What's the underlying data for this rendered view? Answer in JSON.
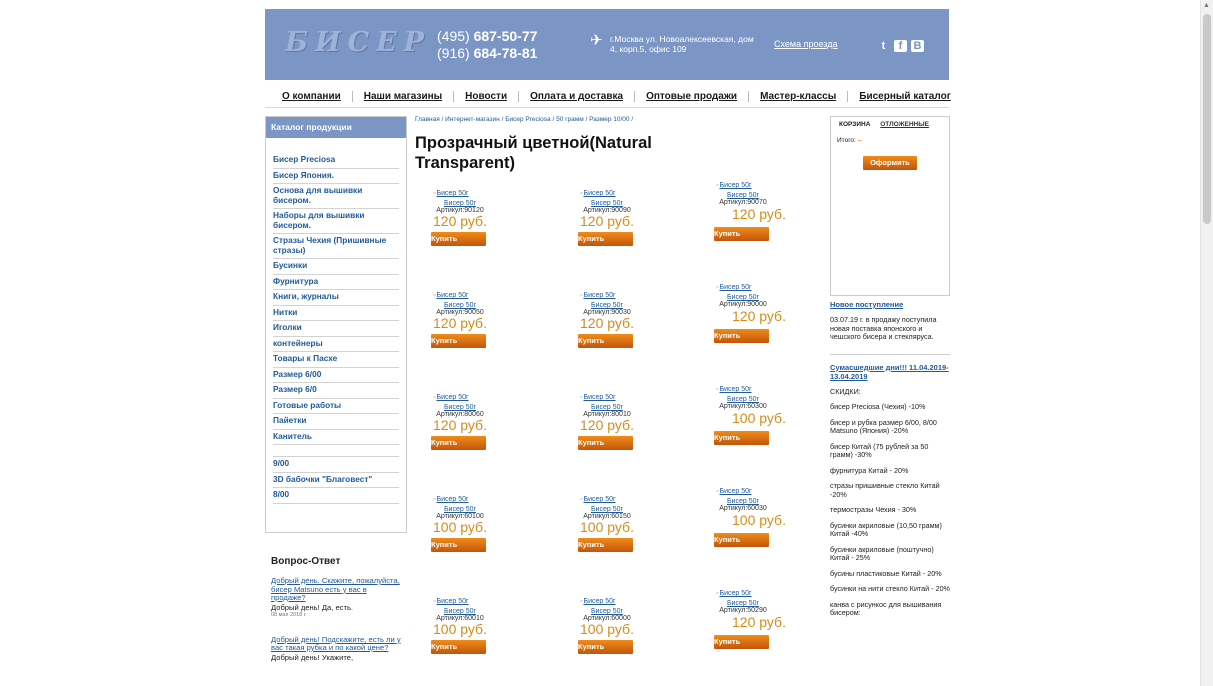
{
  "header": {
    "logo": "БИСЕР",
    "phone1_code": "(495)",
    "phone1": "687-50-77",
    "phone2_code": "(916)",
    "phone2": "684-78-81",
    "address": "г.Москва ул. Новоалексеевская, дом 4, корп.5, офис 109",
    "route_link": "Схема проезда",
    "social": [
      "twitter-icon",
      "facebook-icon",
      "vk-icon"
    ]
  },
  "nav": [
    "О компании",
    "Наши магазины",
    "Новости",
    "Оплата и доставка",
    "Оптовые продажи",
    "Мастер-классы",
    "Бисерный каталог"
  ],
  "sidebar": {
    "title": "Каталог продукции",
    "items": [
      "Бисер Preciosa",
      "Бисер Япония.",
      "Основа для вышивки бисером.",
      "Наборы для вышивки бисером.",
      "Стразы Чехия (Пришивные стразы)",
      "Бусинки",
      "Фурнитура",
      "Книги, журналы",
      "Нитки",
      "Иголки",
      "контейнеры",
      "Товары к Пасхе",
      "Размер 6/00",
      "Размер 6/0",
      "Готовые работы",
      "Пайетки",
      "Канитель",
      "",
      "9/00",
      "3D бабочки \"Благовест\"",
      "8/00"
    ]
  },
  "faq": {
    "title": "Вопрос-Ответ",
    "items": [
      {
        "q": "Добрый день. Скажите, пожалуйста, бисер Matsuno есть у вас в продаже?",
        "a": "Добрый день! Да, есть.",
        "d": "08 мая 2018 г."
      },
      {
        "q": "Добрый день! Подскажите, есть ли у вас такая рубка и по какой цене?",
        "a": "Добрый день! Укажите,",
        "d": ""
      }
    ]
  },
  "breadcrumb": [
    "Главная",
    "Интернет-магазин",
    "Бисер Preciosa",
    "50 грамм",
    "Размер 10/00"
  ],
  "page_title": "Прозрачный цветной(Natural Transparent)",
  "product_image_alt": "Бисер 50г",
  "product_name": "Бисер 50г",
  "buy_label": "Купить",
  "products": [
    {
      "art": "Артикул:90120",
      "price": "120 руб."
    },
    {
      "art": "Артикул:90090",
      "price": "120 руб."
    },
    {
      "art": "Артикул:90070",
      "price": "120 руб."
    },
    {
      "art": "Артикул:90050",
      "price": "120 руб."
    },
    {
      "art": "Артикул:90030",
      "price": "120 руб."
    },
    {
      "art": "Артикул:90000",
      "price": "120 руб."
    },
    {
      "art": "Артикул:80060",
      "price": "120 руб."
    },
    {
      "art": "Артикул:80010",
      "price": "120 руб."
    },
    {
      "art": "Артикул:60300",
      "price": "100 руб."
    },
    {
      "art": "Артикул:60100",
      "price": "100 руб."
    },
    {
      "art": "Артикул:60150",
      "price": "100 руб."
    },
    {
      "art": "Артикул:60030",
      "price": "100 руб."
    },
    {
      "art": "Артикул:60010",
      "price": "100 руб."
    },
    {
      "art": "Артикул:60000",
      "price": "100 руб."
    },
    {
      "art": "Артикул:50290",
      "price": "120 руб."
    }
  ],
  "cart": {
    "tab_cart": "КОРЗИНА",
    "tab_deferred": "ОТЛОЖЕННЫЕ",
    "total_label": "Итого:",
    "total_value": "–",
    "checkout": "Оформить"
  },
  "news": {
    "h1": "Новое поступление",
    "p1": "03.07.19 г. в продажу поступила новая поставка японского и чешского бисера и стекляруса.",
    "h2": "Сумасшедшие дни!!! 11.04.2019-13.04.2019",
    "discounts_title": "СКИДКИ:",
    "discounts": [
      "бисер Preciosa (Чехия) -10%",
      "бисер и рубка размер 6/00, 8/00 Matsuno (Япония) -20%",
      "бисер Китай (75 рублей за 50 грамм) -30%",
      "фурнитура Китай - 20%",
      "стразы пришивные стекло Китай -20%",
      "термостразы Чехия - 30%",
      "бусинки акриловые (10,50 грамм) Китай -40%",
      "бусинки акриловые (поштучно) Китай - 25%",
      "бусины пластиковые Китай - 20%",
      "бусинки на нити стекло Китай - 20%",
      "канва с рисункос для вышивания бисером:"
    ]
  },
  "colors": {
    "header_bg": "#7b96c4",
    "button": "#e07b14",
    "price": "#d98b1a",
    "link": "#1f5a9a"
  }
}
